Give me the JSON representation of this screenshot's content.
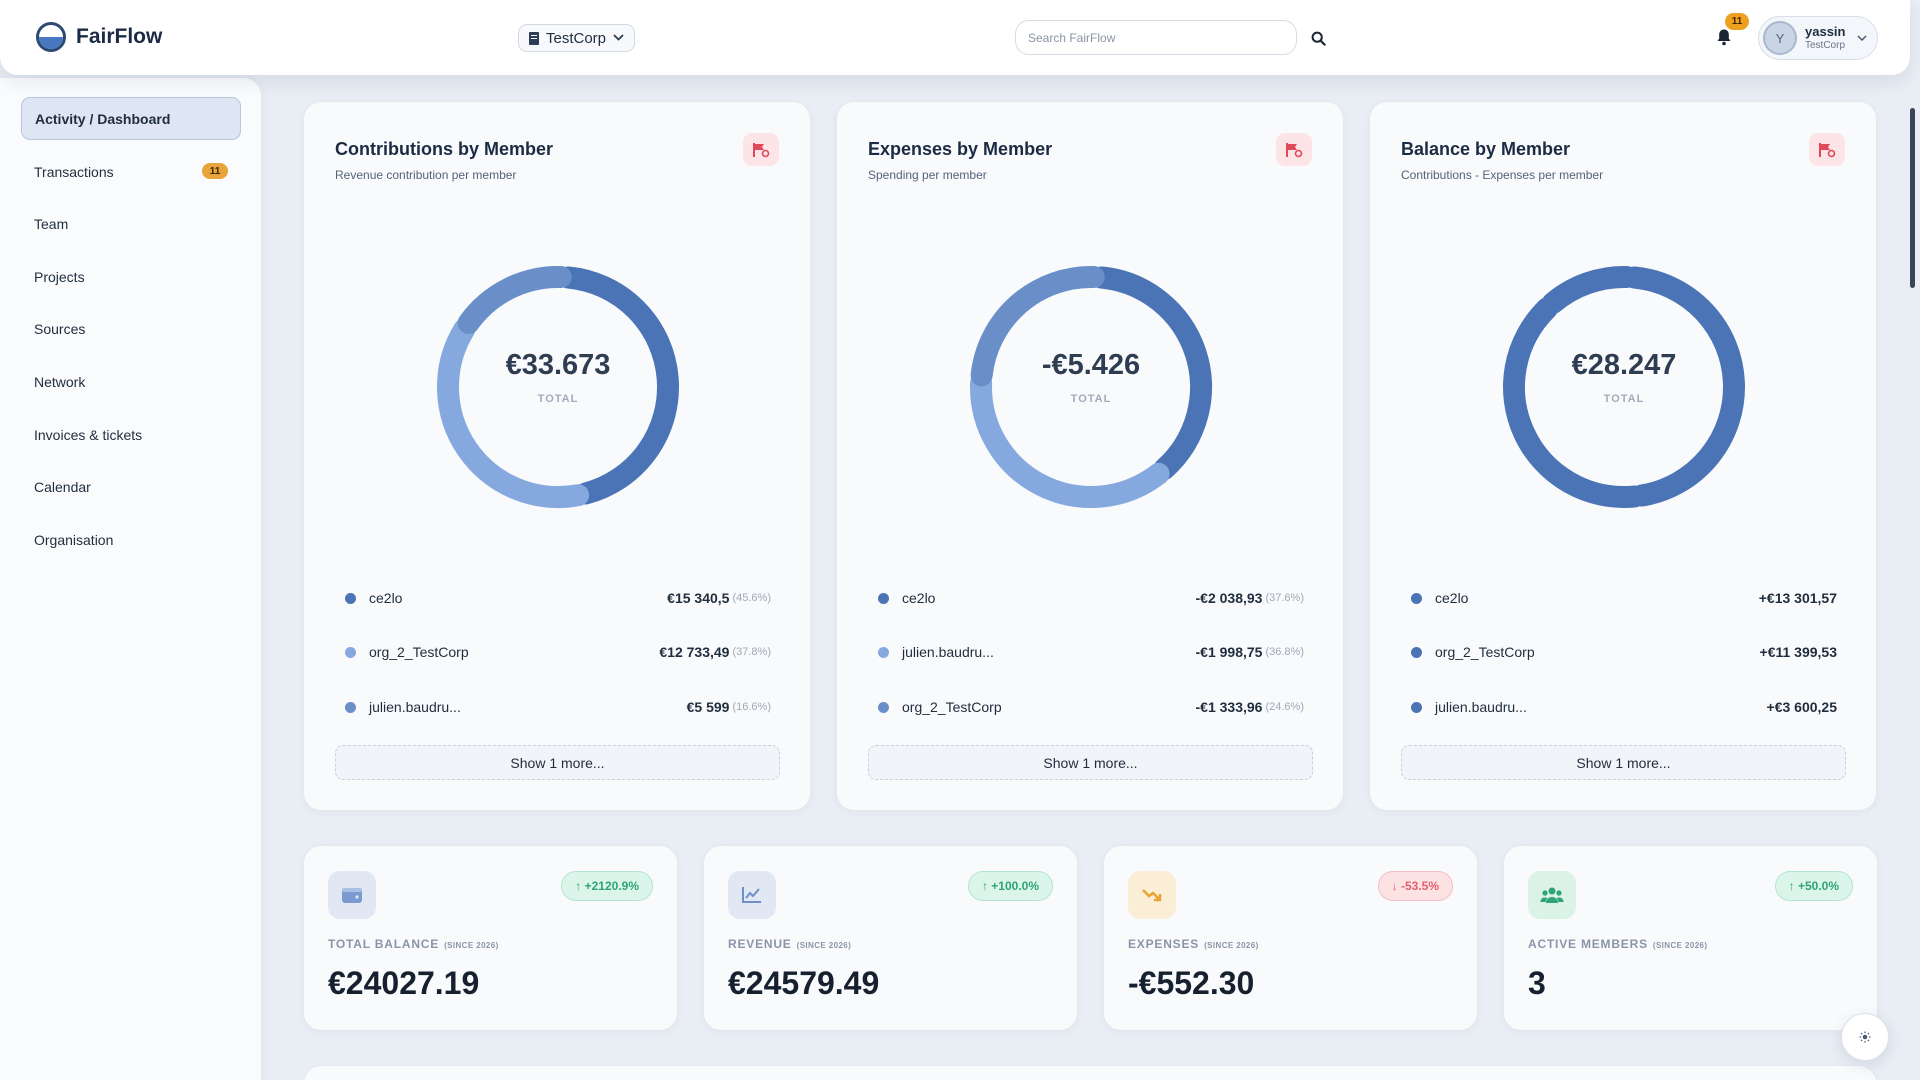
{
  "app": {
    "name": "FairFlow"
  },
  "header": {
    "org": "TestCorp",
    "search_placeholder": "Search FairFlow",
    "notifications": "11",
    "user": {
      "initial": "Y",
      "name": "yassin",
      "org": "TestCorp"
    }
  },
  "sidebar": {
    "items": [
      {
        "label": "Activity / Dashboard",
        "active": true
      },
      {
        "label": "Transactions",
        "badge": "11"
      },
      {
        "label": "Team"
      },
      {
        "label": "Projects"
      },
      {
        "label": "Sources"
      },
      {
        "label": "Network"
      },
      {
        "label": "Invoices & tickets"
      },
      {
        "label": "Calendar"
      },
      {
        "label": "Organisation"
      }
    ]
  },
  "cards": [
    {
      "title": "Contributions by Member",
      "subtitle": "Revenue contribution per member",
      "total": "€33.673",
      "total_label": "TOTAL",
      "legend": [
        {
          "name": "ce2lo",
          "value": "€15 340,5",
          "pct": "(45.6%)",
          "color": "#4a74b5"
        },
        {
          "name": "org_2_TestCorp",
          "value": "€12 733,49",
          "pct": "(37.8%)",
          "color": "#85a9de"
        },
        {
          "name": "julien.baudru...",
          "value": "€5 599",
          "pct": "(16.6%)",
          "color": "#6a8fc8"
        }
      ],
      "show_more": "Show 1 more..."
    },
    {
      "title": "Expenses by Member",
      "subtitle": "Spending per member",
      "total": "-€5.426",
      "total_label": "TOTAL",
      "legend": [
        {
          "name": "ce2lo",
          "value": "-€2 038,93",
          "pct": "(37.6%)",
          "color": "#4a74b5"
        },
        {
          "name": "julien.baudru...",
          "value": "-€1 998,75",
          "pct": "(36.8%)",
          "color": "#85a9de"
        },
        {
          "name": "org_2_TestCorp",
          "value": "-€1 333,96",
          "pct": "(24.6%)",
          "color": "#6a8fc8"
        }
      ],
      "show_more": "Show 1 more..."
    },
    {
      "title": "Balance by Member",
      "subtitle": "Contributions - Expenses per member",
      "total": "€28.247",
      "total_label": "TOTAL",
      "legend": [
        {
          "name": "ce2lo",
          "value": "+€13 301,57",
          "pct": "",
          "color": "#4a74b5"
        },
        {
          "name": "org_2_TestCorp",
          "value": "+€11 399,53",
          "pct": "",
          "color": "#4a74b5"
        },
        {
          "name": "julien.baudru...",
          "value": "+€3 600,25",
          "pct": "",
          "color": "#4a74b5"
        }
      ],
      "show_more": "Show 1 more..."
    }
  ],
  "chart_data": [
    {
      "type": "pie",
      "title": "Contributions by Member",
      "categories": [
        "ce2lo",
        "org_2_TestCorp",
        "julien.baudru..."
      ],
      "values": [
        15340.5,
        12733.49,
        5599
      ],
      "colors": [
        "#4a74b5",
        "#85a9de",
        "#6a8fc8"
      ]
    },
    {
      "type": "pie",
      "title": "Expenses by Member",
      "categories": [
        "ce2lo",
        "julien.baudru...",
        "org_2_TestCorp"
      ],
      "values": [
        2038.93,
        1998.75,
        1333.96
      ],
      "colors": [
        "#4a74b5",
        "#85a9de",
        "#6a8fc8"
      ]
    },
    {
      "type": "pie",
      "title": "Balance by Member",
      "categories": [
        "ce2lo",
        "org_2_TestCorp",
        "julien.baudru..."
      ],
      "values": [
        13301.57,
        11399.53,
        3600.25
      ],
      "colors": [
        "#4a74b5",
        "#4a74b5",
        "#4a74b5"
      ]
    }
  ],
  "stats": [
    {
      "label": "TOTAL BALANCE",
      "since": "(SINCE 2026)",
      "value": "€24027.19",
      "change": "↑ +2120.9%",
      "direction": "up",
      "icon": "wallet-icon",
      "icon_bg": "#e1e8f3",
      "icon_color": "#7b9bd0"
    },
    {
      "label": "REVENUE",
      "since": "(SINCE 2026)",
      "value": "€24579.49",
      "change": "↑ +100.0%",
      "direction": "up",
      "icon": "chart-line-icon",
      "icon_bg": "#e1e8f3",
      "icon_color": "#6f8fcb"
    },
    {
      "label": "EXPENSES",
      "since": "(SINCE 2026)",
      "value": "-€552.30",
      "change": "↓ -53.5%",
      "direction": "down",
      "icon": "trend-down-icon",
      "icon_bg": "#fbeed6",
      "icon_color": "#e8a230"
    },
    {
      "label": "ACTIVE MEMBERS",
      "since": "(SINCE 2026)",
      "value": "3",
      "change": "↑ +50.0%",
      "direction": "up",
      "icon": "users-icon",
      "icon_bg": "#dbf2e7",
      "icon_color": "#2ea37a"
    }
  ]
}
